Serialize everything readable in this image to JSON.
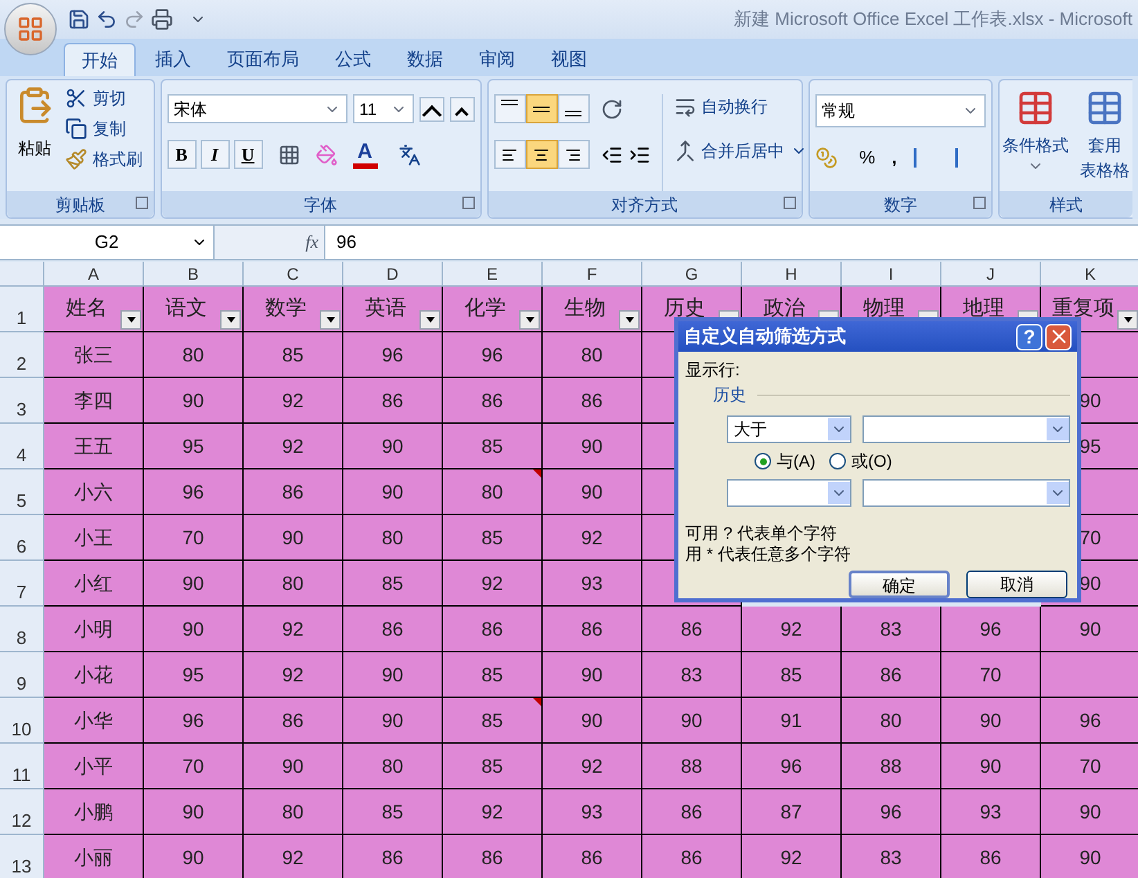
{
  "title_bar": {
    "title": "新建 Microsoft Office Excel 工作表.xlsx - Microsoft"
  },
  "ribbon_tabs": [
    {
      "label": "开始",
      "selected": true
    },
    {
      "label": "插入",
      "selected": false
    },
    {
      "label": "页面布局",
      "selected": false
    },
    {
      "label": "公式",
      "selected": false
    },
    {
      "label": "数据",
      "selected": false
    },
    {
      "label": "审阅",
      "selected": false
    },
    {
      "label": "视图",
      "selected": false
    }
  ],
  "clipboard": {
    "paste": "粘贴",
    "cut": "剪切",
    "copy": "复制",
    "format_painter": "格式刷",
    "label": "剪贴板"
  },
  "font": {
    "name": "宋体",
    "size": "11",
    "bold": "B",
    "italic": "I",
    "underline": "U",
    "font_color": "A",
    "label": "字体"
  },
  "alignment": {
    "vertical": [
      {
        "selected": false
      },
      {
        "selected": true
      },
      {
        "selected": false
      }
    ],
    "horizontal": [
      {
        "selected": false
      },
      {
        "selected": true
      },
      {
        "selected": false
      }
    ],
    "wrap": "自动换行",
    "merge": "合并后居中",
    "label": "对齐方式"
  },
  "number": {
    "format": "常规",
    "percent": "%",
    "comma": ",",
    "label": "数字"
  },
  "styles": {
    "conditional": "条件格式",
    "table_format_1": "套用",
    "table_format_2": "表格格",
    "label": "样式"
  },
  "formula_bar": {
    "name_box": "G2",
    "fx": "fx",
    "value": "96"
  },
  "sheet": {
    "columns": [
      "A",
      "B",
      "C",
      "D",
      "E",
      "F",
      "G",
      "H",
      "I",
      "J",
      "K"
    ],
    "header_row": {
      "number": "1",
      "cells": [
        "姓名",
        "语文",
        "数学",
        "英语",
        "化学",
        "生物",
        "历史",
        "政治",
        "物理",
        "地理",
        "重复项"
      ]
    },
    "rows": [
      {
        "number": "2",
        "cells": [
          "张三",
          "80",
          "85",
          "96",
          "96",
          "80",
          null,
          {
            "covered": true
          },
          {
            "covered": true
          },
          {
            "covered": true
          },
          null
        ]
      },
      {
        "number": "3",
        "cells": [
          "李四",
          "90",
          "92",
          "86",
          "86",
          "86",
          null,
          {
            "covered": true
          },
          {
            "covered": true
          },
          {
            "covered": true
          },
          "90"
        ]
      },
      {
        "number": "4",
        "cells": [
          "王五",
          "95",
          "92",
          "90",
          "85",
          "90",
          null,
          {
            "covered": true
          },
          {
            "covered": true
          },
          {
            "covered": true
          },
          "95"
        ]
      },
      {
        "number": "5",
        "cells": [
          "小六",
          "96",
          "86",
          "90",
          {
            "text": "80",
            "comment": true
          },
          "90",
          null,
          {
            "covered": true
          },
          {
            "covered": true
          },
          {
            "covered": true
          },
          null
        ]
      },
      {
        "number": "6",
        "cells": [
          "小王",
          "70",
          "90",
          "80",
          "85",
          "92",
          null,
          {
            "covered": true
          },
          {
            "covered": true
          },
          {
            "covered": true
          },
          "70"
        ]
      },
      {
        "number": "7",
        "cells": [
          "小红",
          "90",
          "80",
          "85",
          "92",
          "93",
          null,
          {
            "covered": true
          },
          {
            "covered": true
          },
          {
            "covered": true
          },
          "90"
        ]
      },
      {
        "number": "8",
        "cells": [
          "小明",
          "90",
          "92",
          "86",
          "86",
          "86",
          "86",
          "92",
          "83",
          "96",
          "90"
        ]
      },
      {
        "number": "9",
        "cells": [
          "小花",
          "95",
          "92",
          "90",
          "85",
          "90",
          "83",
          "85",
          "86",
          "70",
          null
        ]
      },
      {
        "number": "10",
        "cells": [
          "小华",
          "96",
          "86",
          "90",
          {
            "text": "85",
            "comment": true
          },
          "90",
          "90",
          "91",
          "80",
          "90",
          "96"
        ]
      },
      {
        "number": "11",
        "cells": [
          "小平",
          "70",
          "90",
          "80",
          "85",
          "92",
          "88",
          "96",
          "88",
          "90",
          "70"
        ]
      },
      {
        "number": "12",
        "cells": [
          "小鹏",
          "90",
          "80",
          "85",
          "92",
          "93",
          "86",
          "87",
          "96",
          "93",
          "90"
        ]
      },
      {
        "number": "13",
        "cells": [
          "小丽",
          "90",
          "92",
          "86",
          "86",
          "86",
          "86",
          "92",
          "83",
          "86",
          "90"
        ]
      }
    ]
  },
  "dialog": {
    "title": "自定义自动筛选方式",
    "help": "?",
    "show_rows": "显示行:",
    "field": "历史",
    "condition_1": {
      "operator": "大于"
    },
    "join": [
      {
        "label": "与(A)",
        "selected": true
      },
      {
        "label": "或(O)",
        "selected": false
      }
    ],
    "hints": [
      "可用 ? 代表单个字符",
      "用 * 代表任意多个字符"
    ],
    "buttons": [
      {
        "label": "确定",
        "default": true
      },
      {
        "label": "取消",
        "default": false
      }
    ]
  }
}
